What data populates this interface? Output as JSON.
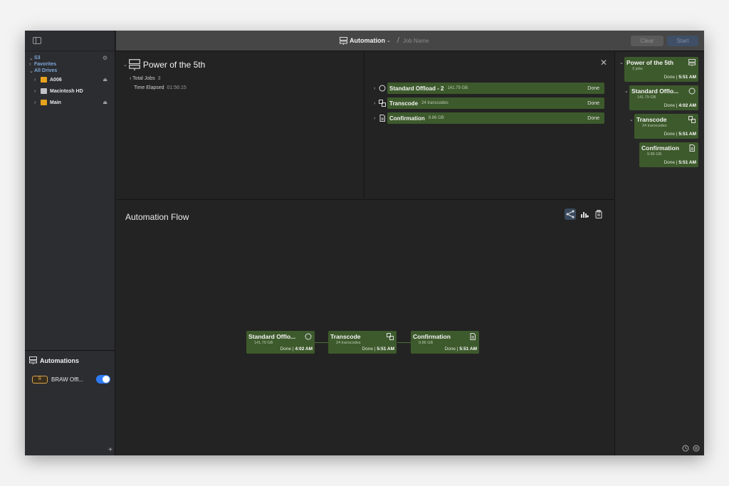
{
  "header": {
    "title": "Automation",
    "job_placeholder": "Job Name",
    "clear_label": "Clear",
    "start_label": "Start"
  },
  "sidebar": {
    "s3_label": "S3",
    "favorites_label": "Favorites",
    "all_drives_label": "All Drives",
    "drives": [
      {
        "label": "A006",
        "icon": "folder-icon",
        "eject": true
      },
      {
        "label": "Macintosh HD",
        "icon": "hard-drive-icon",
        "eject": false
      },
      {
        "label": "Main",
        "icon": "folder-icon",
        "eject": true
      }
    ],
    "automations_title": "Automations",
    "automation_item": {
      "badge": "B",
      "name": "BRAW Offl..."
    },
    "add_label": "+"
  },
  "info": {
    "title": "Power of the 5th",
    "total_jobs_label": "Total Jobs",
    "total_jobs_value": "3",
    "time_elapsed_label": "Time Elapsed",
    "time_elapsed_value": "01:56:15"
  },
  "jobs": [
    {
      "name": "Standard Offload - 2",
      "sub": "141.79 GB",
      "status": "Done",
      "icon": "offload-icon"
    },
    {
      "name": "Transcode",
      "sub": "24 transcodes",
      "status": "Done",
      "icon": "transcode-icon"
    },
    {
      "name": "Confirmation",
      "sub": "9.86 GB",
      "status": "Done",
      "icon": "document-icon"
    }
  ],
  "flow": {
    "title": "Automation Flow",
    "nodes": [
      {
        "title": "Standard Offlo...",
        "sub": "141.79 GB",
        "status": "Done",
        "time": "4:02 AM"
      },
      {
        "title": "Transcode",
        "sub": "24 transcodes",
        "status": "Done",
        "time": "5:51 AM"
      },
      {
        "title": "Confirmation",
        "sub": "9.86 GB",
        "status": "Done",
        "time": "5:51 AM"
      }
    ]
  },
  "right": {
    "nodes": [
      {
        "title": "Power of the 5th",
        "sub": "3 jobs",
        "status": "Done",
        "time": "5:51 AM"
      },
      {
        "title": "Standard Offlo...",
        "sub": "141.79 GB",
        "status": "Done",
        "time": "4:02 AM"
      },
      {
        "title": "Transcode",
        "sub": "24 transcodes",
        "status": "Done",
        "time": "5:51 AM"
      },
      {
        "title": "Confirmation",
        "sub": "9.86 GB",
        "status": "Done",
        "time": "5:51 AM"
      }
    ]
  },
  "colors": {
    "accent_green": "#3d5a2c",
    "toggle_blue": "#2f7bf5",
    "badge_orange": "#d9a24b"
  }
}
